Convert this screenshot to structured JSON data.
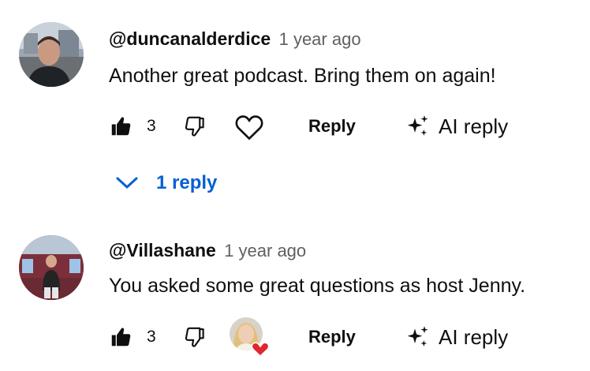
{
  "comments": [
    {
      "author": "@duncanalderdice",
      "time": "1 year ago",
      "text": "Another great podcast. Bring them on again!",
      "likes": "3",
      "reply_label": "Reply",
      "ai_reply_label": "AI reply",
      "replies_toggle": "1 reply",
      "heart_icon": "heart-outline-icon"
    },
    {
      "author": "@Villashane",
      "time": "1 year ago",
      "text": "You asked some great questions as host Jenny.",
      "likes": "3",
      "reply_label": "Reply",
      "ai_reply_label": "AI reply",
      "heart_icon": "creator-heart-icon"
    }
  ],
  "colors": {
    "link_blue": "#065fd4",
    "heart_red": "#e0262f",
    "secondary_text": "#606060"
  }
}
